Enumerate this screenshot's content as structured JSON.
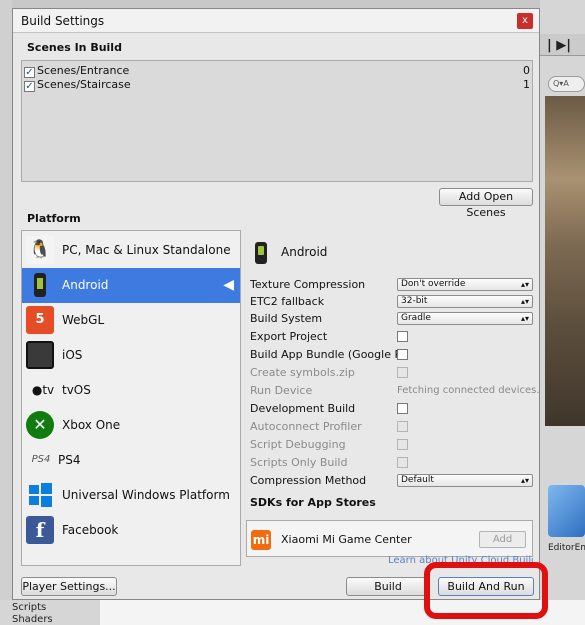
{
  "window": {
    "title": "Build Settings",
    "close_label": "x"
  },
  "scenes": {
    "header": "Scenes In Build",
    "items": [
      {
        "path": "Scenes/Entrance",
        "checked": true,
        "index": "0"
      },
      {
        "path": "Scenes/Staircase",
        "checked": true,
        "index": "1"
      }
    ],
    "add_button": "Add Open Scenes"
  },
  "platform": {
    "header": "Platform",
    "items": [
      {
        "label": "PC, Mac & Linux Standalone",
        "icon": "pc-mac-linux-icon",
        "selected": false
      },
      {
        "label": "Android",
        "icon": "android-icon",
        "selected": true
      },
      {
        "label": "WebGL",
        "icon": "html5-icon",
        "selected": false
      },
      {
        "label": "iOS",
        "icon": "ios-device-icon",
        "selected": false
      },
      {
        "label": "tvOS",
        "icon": "apple-tv-icon",
        "selected": false
      },
      {
        "label": "Xbox One",
        "icon": "xbox-icon",
        "selected": false
      },
      {
        "label": "PS4",
        "icon": "ps4-icon",
        "selected": false
      },
      {
        "label": "Universal Windows Platform",
        "icon": "windows-icon",
        "selected": false
      },
      {
        "label": "Facebook",
        "icon": "facebook-icon",
        "selected": false
      }
    ],
    "ps4_logo": "PS4",
    "tv_logo": "tv"
  },
  "settings": {
    "platform_title": "Android",
    "texture_compression": {
      "label": "Texture Compression",
      "value": "Don't override"
    },
    "etc2_fallback": {
      "label": "ETC2 fallback",
      "value": "32-bit"
    },
    "build_system": {
      "label": "Build System",
      "value": "Gradle"
    },
    "export_project": {
      "label": "Export Project",
      "checked": false
    },
    "build_app_bundle": {
      "label": "Build App Bundle (Google Play)",
      "checked": false
    },
    "create_symbols": {
      "label": "Create symbols.zip",
      "checked": false,
      "disabled": true
    },
    "run_device": {
      "label": "Run Device",
      "value": "Fetching connected devices."
    },
    "development_build": {
      "label": "Development Build",
      "checked": false
    },
    "autoconnect_profiler": {
      "label": "Autoconnect Profiler",
      "checked": false,
      "disabled": true
    },
    "script_debugging": {
      "label": "Script Debugging",
      "checked": false,
      "disabled": true
    },
    "scripts_only_build": {
      "label": "Scripts Only Build",
      "checked": false,
      "disabled": true
    },
    "compression_method": {
      "label": "Compression Method",
      "value": "Default"
    },
    "sdks_header": "SDKs for App Stores",
    "sdk_item": {
      "label": "Xiaomi Mi Game Center",
      "add_label": "Add",
      "icon_text": "mi"
    },
    "cloud_link": "Learn about Unity Cloud Build"
  },
  "footer": {
    "player_settings": "Player Settings...",
    "build": "Build",
    "build_and_run": "Build And Run"
  },
  "background": {
    "search_placeholder": "Q▾A",
    "asset_label": "EditorEm",
    "project_items": [
      "Scripts",
      "Shaders"
    ],
    "dropdown_glyph": "s ▾"
  },
  "colors": {
    "selection": "#3d7be0",
    "highlight_ring": "#e01010",
    "link": "#5b83c6"
  }
}
